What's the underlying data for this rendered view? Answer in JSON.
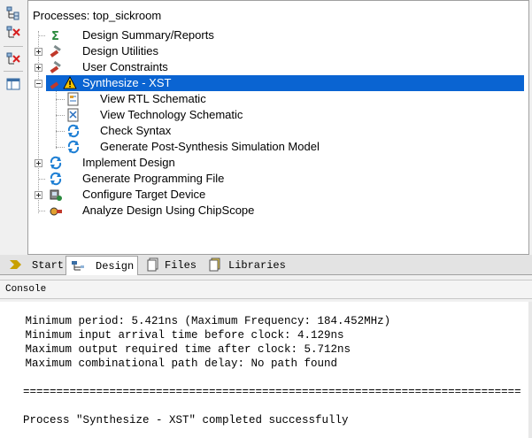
{
  "processes_panel": {
    "title": "Processes: top_sickroom",
    "items": [
      {
        "label": "Design Summary/Reports",
        "icon": "sigma-icon",
        "expander": "none"
      },
      {
        "label": "Design Utilities",
        "icon": "tools-icon",
        "expander": "plus"
      },
      {
        "label": "User Constraints",
        "icon": "tools-icon",
        "expander": "plus"
      },
      {
        "label": "Synthesize - XST",
        "icon": "warning-icon",
        "expander": "minus",
        "selected": true
      },
      {
        "label": "View RTL Schematic",
        "icon": "schematic-icon",
        "child": true
      },
      {
        "label": "View Technology Schematic",
        "icon": "tech-schematic-icon",
        "child": true
      },
      {
        "label": "Check Syntax",
        "icon": "refresh-icon",
        "child": true
      },
      {
        "label": "Generate Post-Synthesis Simulation Model",
        "icon": "refresh-icon",
        "child": true
      },
      {
        "label": "Implement Design",
        "icon": "refresh-icon",
        "expander": "plus"
      },
      {
        "label": "Generate Programming File",
        "icon": "refresh-icon",
        "expander": "none"
      },
      {
        "label": "Configure Target Device",
        "icon": "device-icon",
        "expander": "plus"
      },
      {
        "label": "Analyze Design Using ChipScope",
        "icon": "chipscope-icon",
        "expander": "none"
      }
    ]
  },
  "tabs": [
    {
      "label": "Start",
      "icon": "start-arrow-icon",
      "active": false
    },
    {
      "label": "Design",
      "icon": "design-icon",
      "active": true
    },
    {
      "label": "Files",
      "icon": "files-icon",
      "active": false
    },
    {
      "label": "Libraries",
      "icon": "libraries-icon",
      "active": false
    }
  ],
  "console": {
    "title": "Console",
    "lines": [
      "   Minimum period: 5.421ns (Maximum Frequency: 184.452MHz)",
      "   Minimum input arrival time before clock: 4.129ns",
      "   Maximum output required time after clock: 5.712ns",
      "   Maximum combinational path delay: No path found",
      "===========================================================================",
      "Process \"Synthesize - XST\" completed successfully"
    ]
  },
  "colors": {
    "selection": "#0a64d2",
    "warning": "#f5c400",
    "refresh": "#1e7fd4"
  }
}
